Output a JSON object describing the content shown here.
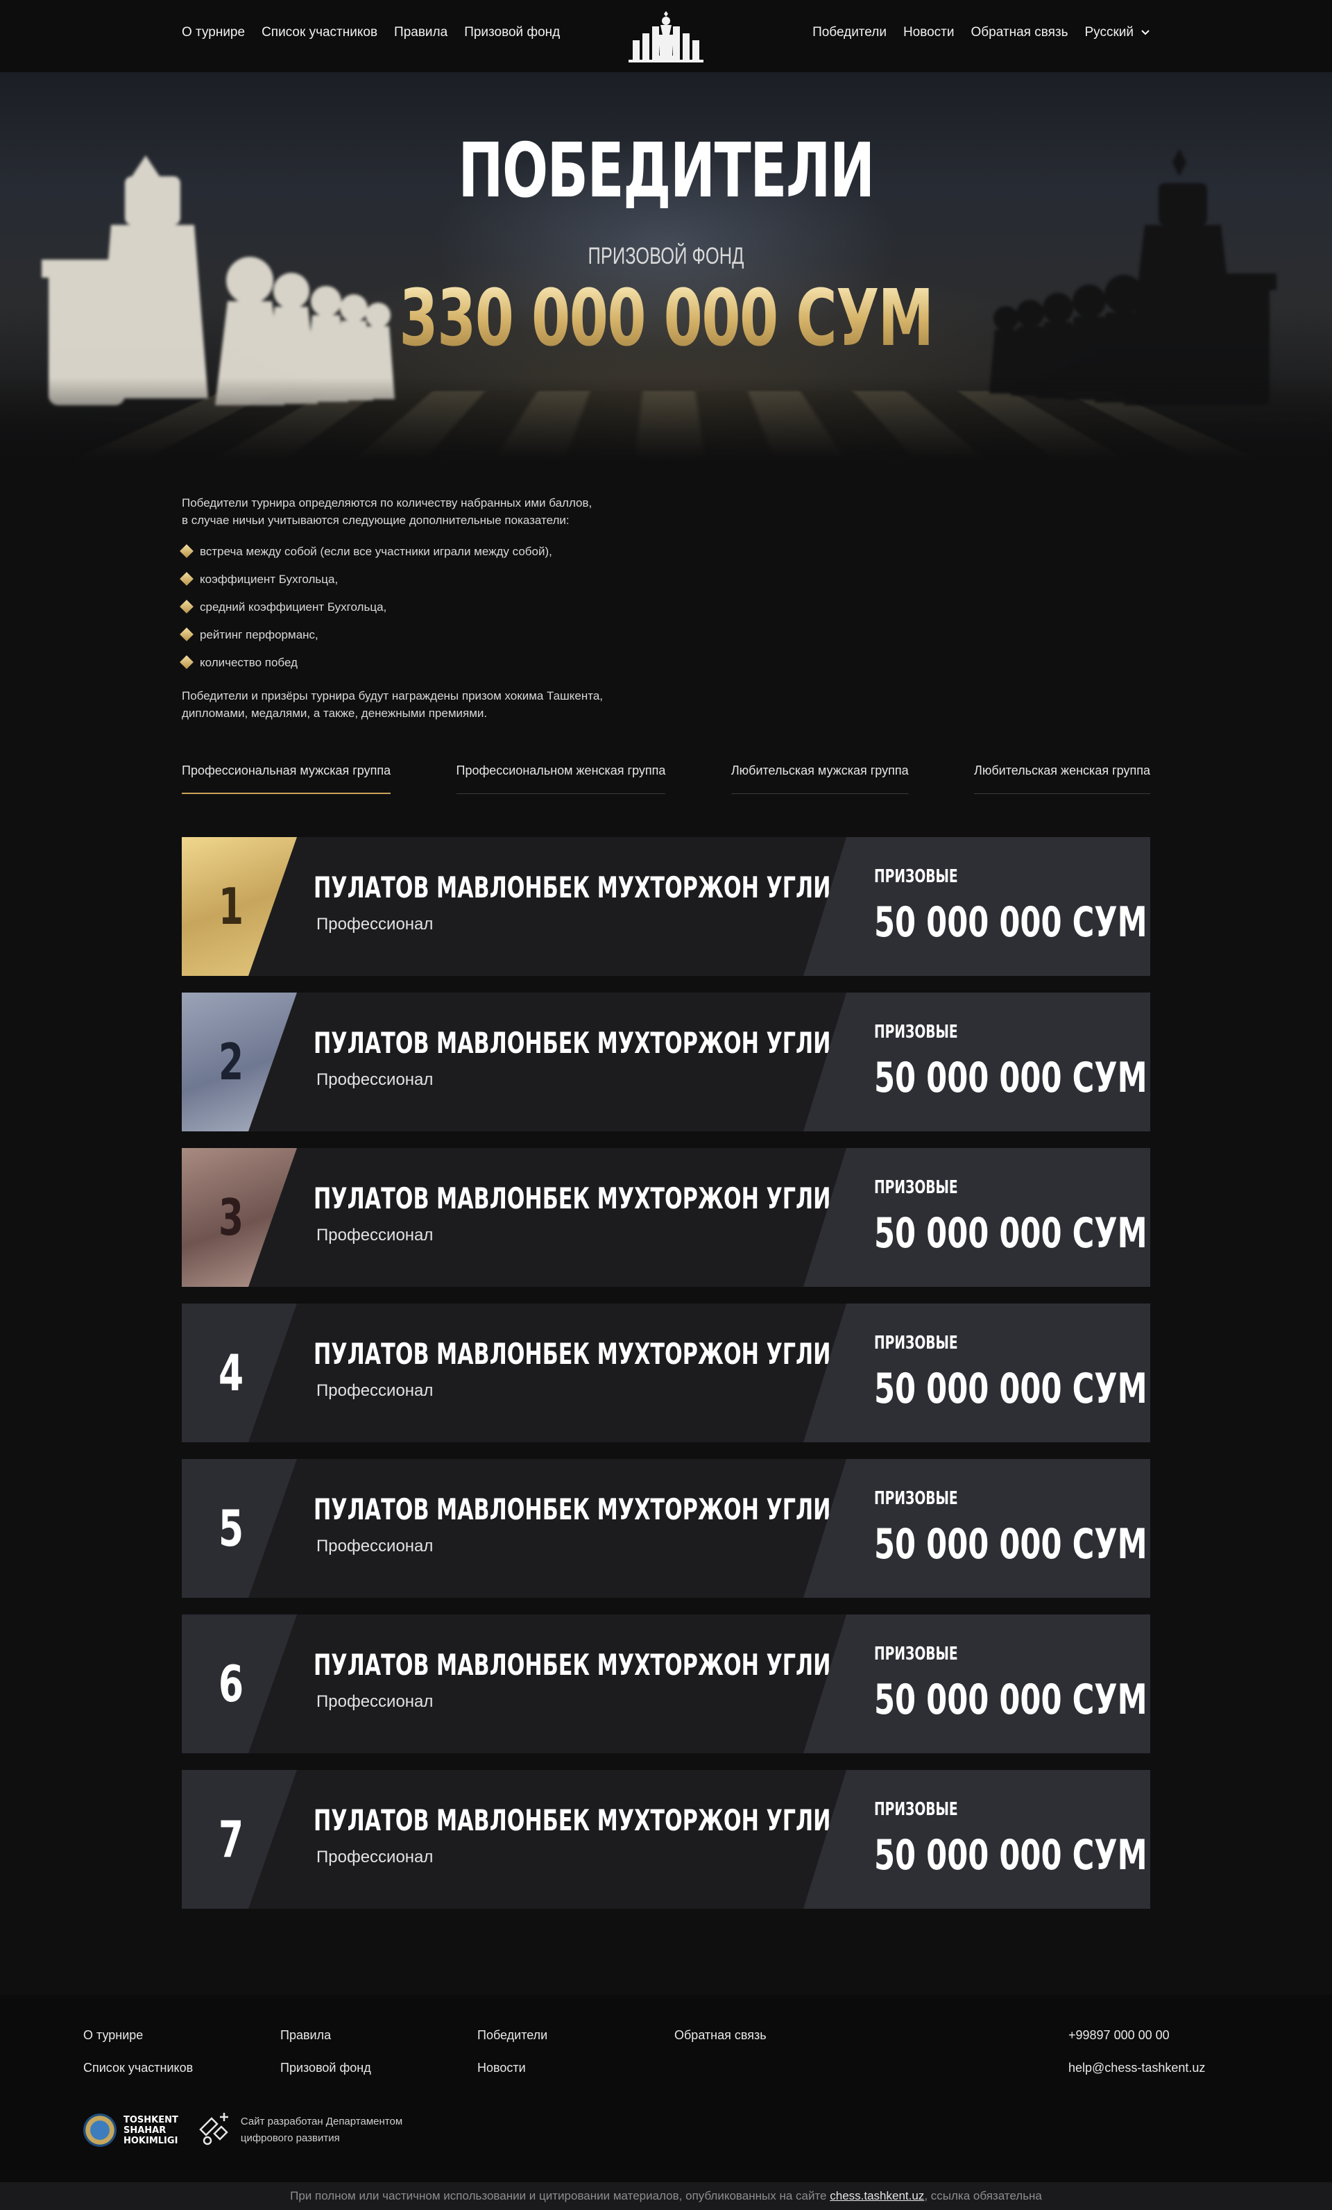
{
  "nav": {
    "left": [
      "О турнире",
      "Список участников",
      "Правила",
      "Призовой фонд"
    ],
    "right": [
      "Победители",
      "Новости",
      "Обратная связь"
    ],
    "language": "Русский"
  },
  "hero": {
    "title": "ПОБЕДИТЕЛИ",
    "subtitle": "ПРИЗОВОЙ ФОНД",
    "amount": "330 000 000 СУМ"
  },
  "intro": {
    "line1": "Победители турнира определяются по количеству набранных ими баллов,",
    "line2": "в случае ничьи учитываются следующие дополнительные показатели:",
    "criteria": [
      "встреча между собой (если все участники играли между собой),",
      "коэффициент Бухгольца,",
      "средний коэффициент Бухгольца,",
      "рейтинг перформанс,",
      "количество побед"
    ],
    "outro1": "Победители и призёры турнира будут награждены призом хокима Ташкента,",
    "outro2": "дипломами, медалями, а также, денежными премиями."
  },
  "tabs": [
    "Профессиональная мужская группа",
    "Профессиональном женская группа",
    "Любительская мужская группа",
    "Любительская женская группа"
  ],
  "active_tab": 0,
  "winners": [
    {
      "rank": "1",
      "name": "ПУЛАТОВ МАВЛОНБЕК МУХТОРЖОН УГЛИ",
      "status": "Профессионал",
      "prize_label": "ПРИЗОВЫЕ",
      "prize": "50 000 000 СУМ",
      "medal": "gold"
    },
    {
      "rank": "2",
      "name": "ПУЛАТОВ МАВЛОНБЕК МУХТОРЖОН УГЛИ",
      "status": "Профессионал",
      "prize_label": "ПРИЗОВЫЕ",
      "prize": "50 000 000 СУМ",
      "medal": "silver"
    },
    {
      "rank": "3",
      "name": "ПУЛАТОВ МАВЛОНБЕК МУХТОРЖОН УГЛИ",
      "status": "Профессионал",
      "prize_label": "ПРИЗОВЫЕ",
      "prize": "50 000 000 СУМ",
      "medal": "bronze"
    },
    {
      "rank": "4",
      "name": "ПУЛАТОВ МАВЛОНБЕК МУХТОРЖОН УГЛИ",
      "status": "Профессионал",
      "prize_label": "ПРИЗОВЫЕ",
      "prize": "50 000 000 СУМ",
      "medal": "none"
    },
    {
      "rank": "5",
      "name": "ПУЛАТОВ МАВЛОНБЕК МУХТОРЖОН УГЛИ",
      "status": "Профессионал",
      "prize_label": "ПРИЗОВЫЕ",
      "prize": "50 000 000 СУМ",
      "medal": "none"
    },
    {
      "rank": "6",
      "name": "ПУЛАТОВ МАВЛОНБЕК МУХТОРЖОН УГЛИ",
      "status": "Профессионал",
      "prize_label": "ПРИЗОВЫЕ",
      "prize": "50 000 000 СУМ",
      "medal": "none"
    },
    {
      "rank": "7",
      "name": "ПУЛАТОВ МАВЛОНБЕК МУХТОРЖОН УГЛИ",
      "status": "Профессионал",
      "prize_label": "ПРИЗОВЫЕ",
      "prize": "50 000 000 СУМ",
      "medal": "none"
    }
  ],
  "footer": {
    "col1": [
      "О турнире",
      "Список участников"
    ],
    "col2": [
      "Правила",
      "Призовой фонд"
    ],
    "col3": [
      "Победители",
      "Новости"
    ],
    "col4": [
      "Обратная связь"
    ],
    "contacts": [
      "+99897 000 00 00",
      "help@chess-tashkent.uz"
    ],
    "hokim_logo": [
      "TOSHKENT",
      "SHAHAR",
      "HOKIMLIGI"
    ],
    "dev_line1": "Сайт разработан Департаментом",
    "dev_line2": "цифрового развития",
    "copyright_before": "При полном или частичном использовании и цитировании материалов, опубликованных на сайте ",
    "copyright_link": "chess.tashkent.uz",
    "copyright_after": ", ссылка обязательна"
  },
  "colors": {
    "accent": "#c9a359",
    "background": "#0f0f10",
    "card": "#1c1c1e",
    "prize_box": "#2e2e35"
  }
}
